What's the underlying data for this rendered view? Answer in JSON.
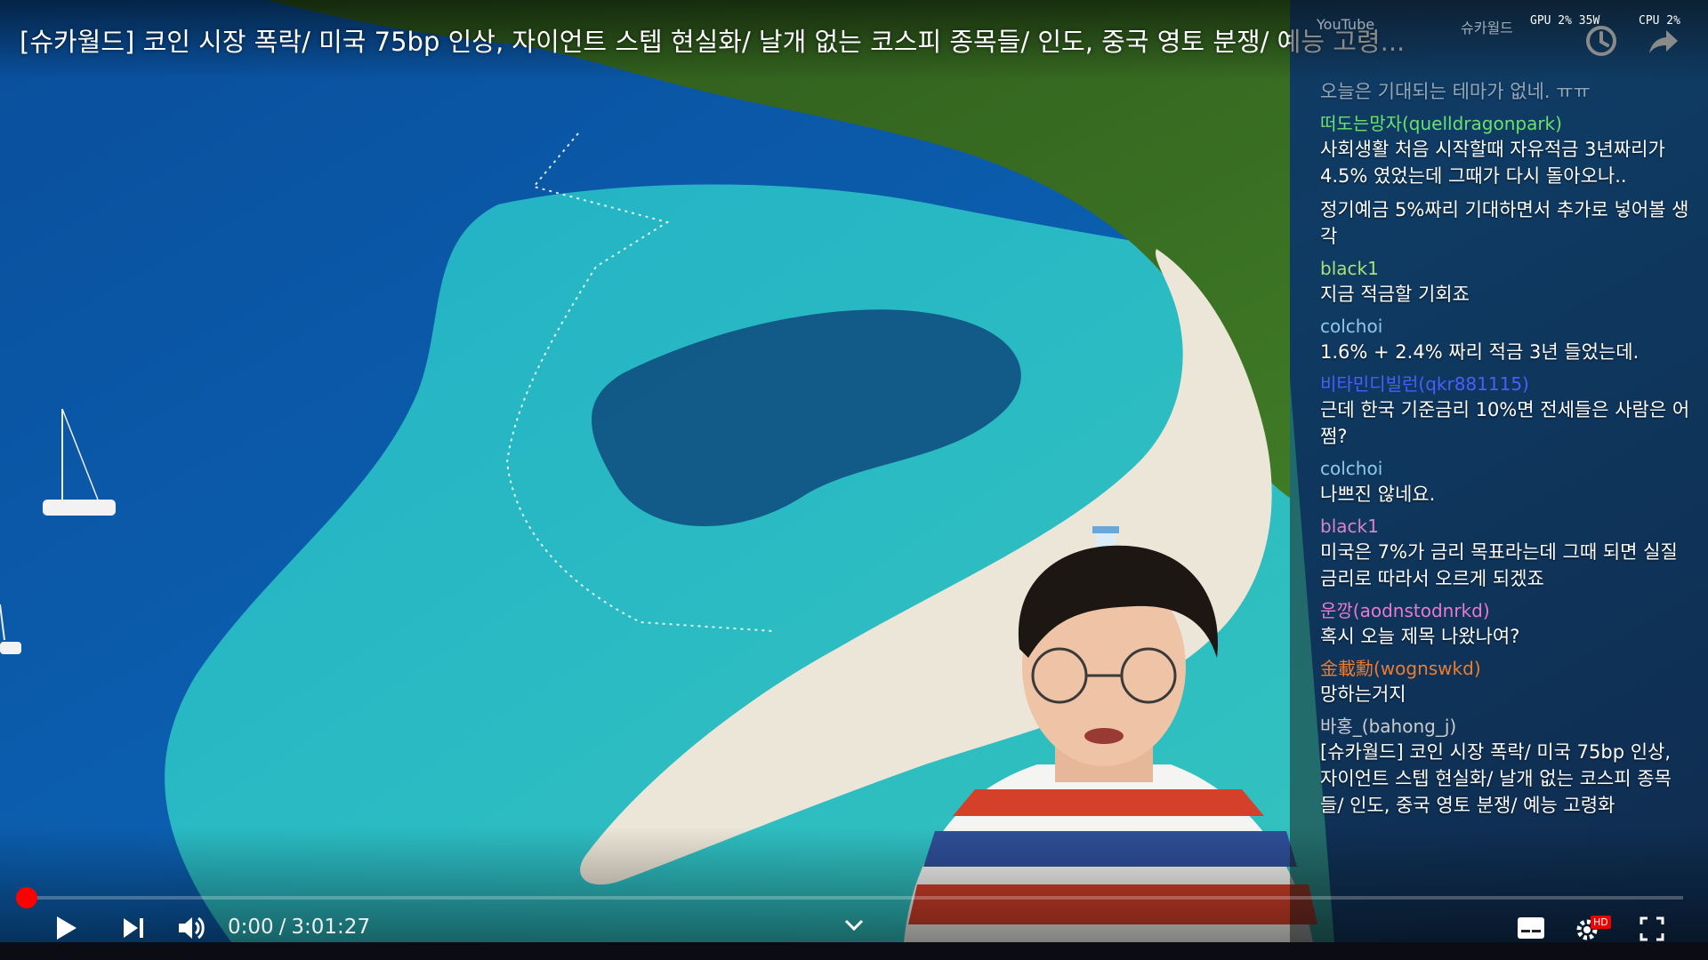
{
  "player": {
    "title": "[슈카월드] 코인 시장 폭락/ 미국 75bp 인상, 자이언트 스텝 현실화/ 날개 없는 코스피 종목들/ 인도, 중국 영토 분쟁/ 예능 고령...",
    "time_current": "0:00",
    "time_total": "3:01:27",
    "progress": 0,
    "accent_color": "#ff0000",
    "icons": {
      "play": "play-icon",
      "next": "next-icon",
      "volume": "volume-icon",
      "expand": "chevron-down-icon",
      "subtitles": "subtitles-icon",
      "settings": "gear-icon",
      "fullscreen": "fullscreen-icon",
      "watch_later": "clock-icon",
      "share": "share-icon"
    },
    "quality_badge": "HD"
  },
  "overlay": {
    "gpu": "GPU 2% 35W",
    "cpu": "CPU 2%",
    "header_left": "YouTube",
    "header_mid": "슈카월드"
  },
  "chat": {
    "messages": [
      {
        "user": "",
        "text": "오늘은 기대되는 테마가 없네. ㅠㅠ",
        "color": "#b9dda0",
        "dim": true
      },
      {
        "user": "떠도는망자(quelldragonpark)",
        "text": "사회생활 처음 시작할때 자유적금 3년짜리가 4.5% 였었는데 그때가 다시 돌아오나..",
        "color": "#6ce06c",
        "dim": false
      },
      {
        "user": "",
        "text": "정기예금 5%짜리 기대하면서 추가로 넣어볼 생각",
        "color": "#ffffff",
        "dim": false
      },
      {
        "user": "black1",
        "text": "지금 적금할 기회죠",
        "color": "#a8e07a",
        "dim": false
      },
      {
        "user": "colchoi",
        "text": "1.6% + 2.4% 짜리 적금 3년 들었는데.",
        "color": "#8fc8ec",
        "dim": false
      },
      {
        "user": "비타민디빌런(qkr881115)",
        "text": "근데 한국 기준금리 10%면 전세들은 사람은 어쩜?",
        "color": "#4c5cff",
        "dim": false
      },
      {
        "user": "colchoi",
        "text": "나쁘진 않네요.",
        "color": "#8fc8ec",
        "dim": false
      },
      {
        "user": "black1",
        "text": "미국은 7%가 금리 목표라는데 그때 되면 실질금리로 따라서 오르게 되겠죠",
        "color": "#d884c8",
        "dim": false
      },
      {
        "user": "운깡(aodnstodnrkd)",
        "text": "혹시 오늘 제목 나왔나여?",
        "color": "#e87ad0",
        "dim": false
      },
      {
        "user": "金載勳(wognswkd)",
        "text": "망하는거지",
        "color": "#f07c2c",
        "dim": false
      },
      {
        "user": "바홍_(bahong_j)",
        "text": "[슈카월드] 코인 시장 폭락/ 미국 75bp 인상, 자이언트 스텝 현실화/ 날개 없는 코스피 종목들/ 인도, 중국 영토 분쟁/ 예능 고령화",
        "color": "#cccccc",
        "dim": false
      }
    ]
  }
}
